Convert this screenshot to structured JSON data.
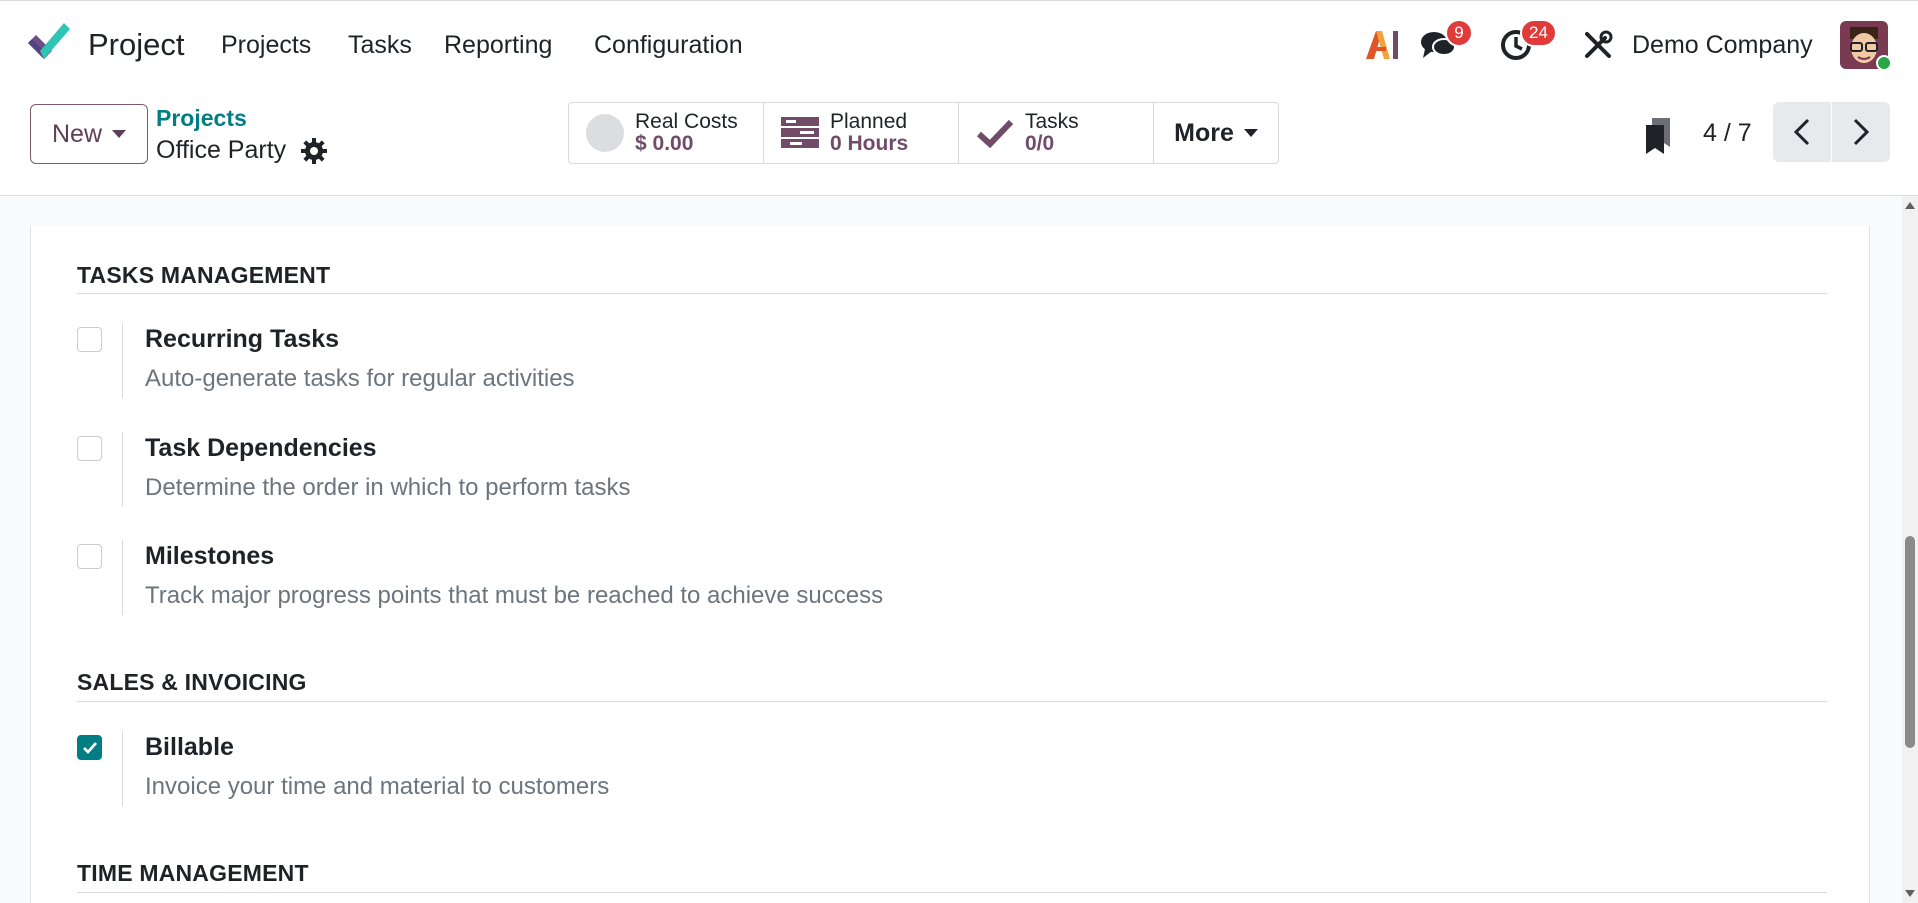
{
  "app": {
    "name": "Project"
  },
  "nav": {
    "menus": [
      "Projects",
      "Tasks",
      "Reporting",
      "Configuration"
    ]
  },
  "systray": {
    "ai_label": "AI",
    "messages_count": "9",
    "activities_count": "24",
    "company": "Demo Company"
  },
  "control": {
    "new_label": "New",
    "breadcrumb_parent": "Projects",
    "breadcrumb_current": "Office Party",
    "stats": [
      {
        "label": "Real Costs",
        "value": "$ 0.00",
        "icon": "circle-icon"
      },
      {
        "label": "Planned",
        "value": "0 Hours",
        "icon": "planning-icon"
      },
      {
        "label": "Tasks",
        "value": "0/0",
        "icon": "check-icon"
      }
    ],
    "more_label": "More",
    "pager": "4 / 7"
  },
  "sections": {
    "tasks_management": {
      "title": "TASKS MANAGEMENT",
      "options": [
        {
          "title": "Recurring Tasks",
          "desc": "Auto-generate tasks for regular activities",
          "checked": false
        },
        {
          "title": "Task Dependencies",
          "desc": "Determine the order in which to perform tasks",
          "checked": false
        },
        {
          "title": "Milestones",
          "desc": "Track major progress points that must be reached to achieve success",
          "checked": false
        }
      ]
    },
    "sales_invoicing": {
      "title": "SALES & INVOICING",
      "options": [
        {
          "title": "Billable",
          "desc": "Invoice your time and material to customers",
          "checked": true
        }
      ]
    },
    "time_management": {
      "title": "TIME MANAGEMENT"
    }
  },
  "colors": {
    "accent": "#017e84",
    "brand": "#714b67",
    "badge": "#e03b3b"
  }
}
